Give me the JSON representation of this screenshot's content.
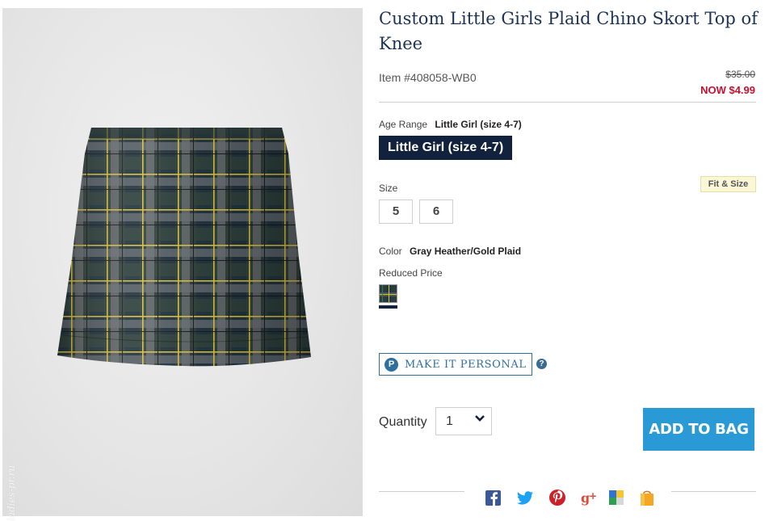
{
  "product": {
    "title": "Custom Little Girls Plaid Chino Skort Top of Knee",
    "item_number": "Item #408058-WB0",
    "price_original": "$35.00",
    "price_now": "NOW $4.99"
  },
  "age_range": {
    "label": "Age Range",
    "value": "Little Girl (size 4-7)",
    "selected_option": "Little Girl (size 4-7)"
  },
  "size": {
    "label": "Size",
    "options": [
      "5",
      "6"
    ],
    "fit_link": "Fit & Size"
  },
  "color": {
    "label": "Color",
    "value": "Gray Heather/Gold Plaid",
    "group_label": "Reduced Price"
  },
  "personalize": {
    "badge": "P",
    "label": "MAKE IT PERSONAL",
    "help": "?"
  },
  "quantity": {
    "label": "Quantity",
    "value": "1"
  },
  "cta": {
    "add_to_bag": "ADD TO BAG"
  },
  "watermark": "ladies-pr.ru",
  "social_icons": [
    "facebook-icon",
    "twitter-icon",
    "pinterest-icon",
    "google-plus-icon",
    "delicious-icon",
    "shopping-bag-icon"
  ],
  "colors": {
    "title": "#1d3352",
    "sale_price": "#c8102e",
    "selected_bg": "#12223d",
    "cta_bg": "#2a9ad6",
    "personal_blue": "#2f6f9f"
  }
}
